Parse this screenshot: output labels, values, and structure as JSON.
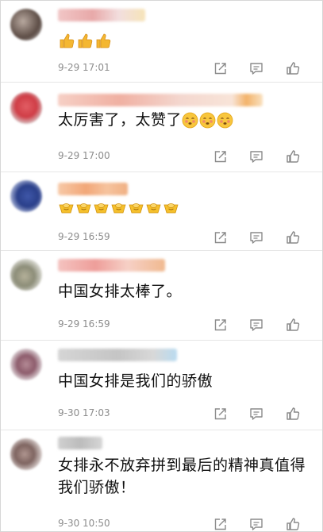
{
  "comments": [
    {
      "text": "",
      "timestamp": "9-29 17:01",
      "emoji": [
        "thumbs-up",
        "thumbs-up",
        "thumbs-up"
      ]
    },
    {
      "text": "太厉害了，太赞了",
      "timestamp": "9-29 17:00",
      "emoji": [
        "blush-face",
        "blush-face",
        "blush-face"
      ]
    },
    {
      "text": "",
      "timestamp": "9-29 16:59",
      "emoji": [
        "gold-ingot",
        "gold-ingot",
        "gold-ingot",
        "gold-ingot",
        "gold-ingot",
        "gold-ingot",
        "gold-ingot"
      ]
    },
    {
      "text": "中国女排太棒了。",
      "timestamp": "9-29 16:59",
      "emoji": []
    },
    {
      "text": "中国女排是我们的骄傲",
      "timestamp": "9-30 17:03",
      "emoji": []
    },
    {
      "text": "女排永不放弃拼到最后的精神真值得我们骄傲！",
      "timestamp": "9-30 10:50",
      "emoji": []
    }
  ],
  "icons": {
    "share": "share-icon",
    "reply": "comment-icon",
    "like": "thumbs-up-icon"
  },
  "colors": {
    "timestamp": "#8c8c8c",
    "icon": "#8a8a8a",
    "divider": "#e6e6e6",
    "emoji_yellow": "#f4b731"
  }
}
